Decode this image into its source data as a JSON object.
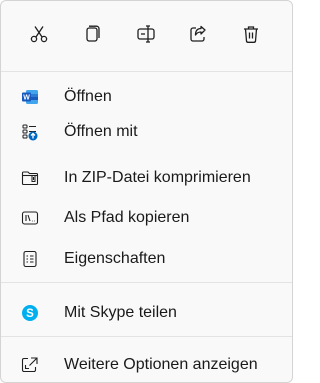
{
  "toolbar": {
    "buttons": [
      {
        "icon": "cut-icon"
      },
      {
        "icon": "copy-icon"
      },
      {
        "icon": "rename-icon"
      },
      {
        "icon": "share-icon"
      },
      {
        "icon": "delete-icon"
      }
    ]
  },
  "menu": {
    "items": [
      {
        "label": "Öffnen",
        "icon": "word-app-icon"
      },
      {
        "label": "Öffnen mit",
        "icon": "open-with-icon"
      },
      {
        "label": "In ZIP-Datei komprimieren",
        "icon": "zip-folder-icon"
      },
      {
        "label": "Als Pfad kopieren",
        "icon": "copy-path-icon"
      },
      {
        "label": "Eigenschaften",
        "icon": "properties-icon"
      },
      {
        "label": "Mit Skype teilen",
        "icon": "skype-icon"
      },
      {
        "label": "Weitere Optionen anzeigen",
        "icon": "more-options-icon"
      }
    ]
  },
  "colors": {
    "word_blue": "#185abd",
    "skype_blue": "#00aff0",
    "accent_blue": "#0067c0",
    "icon_gray": "#1f1f1f"
  }
}
